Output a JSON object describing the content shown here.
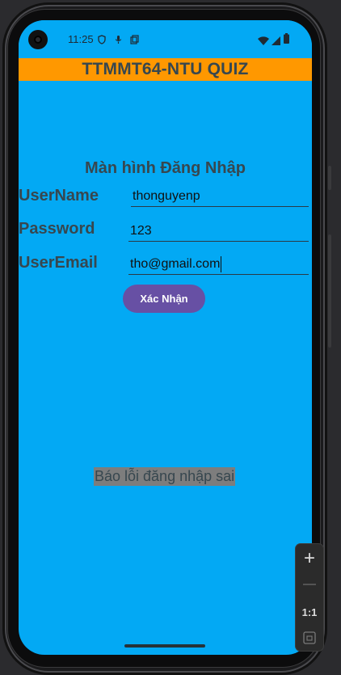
{
  "status_bar": {
    "time": "11:25",
    "icons": [
      "shield-icon",
      "mic-icon",
      "screenshot-icon",
      "wifi-icon",
      "signal-icon",
      "battery-icon"
    ]
  },
  "app_bar": {
    "title": "TTMMT64-NTU QUIZ",
    "color": "#ff9800"
  },
  "login": {
    "title": "Màn hình Đăng Nhập",
    "username_label": "UserName",
    "username_value": "thonguyenp",
    "password_label": "Password",
    "password_value": "123",
    "email_label": "UserEmail",
    "email_value": "tho@gmail.com",
    "confirm_label": "Xác Nhận",
    "error_text": "Báo lỗi đăng nhập sai"
  },
  "colors": {
    "background": "#03a9f4",
    "button": "#6750a4",
    "error_bg": "#7d7d7d"
  },
  "zoom_controls": {
    "zoom_in": "+",
    "zoom_out": "—",
    "actual_size": "1:1"
  }
}
